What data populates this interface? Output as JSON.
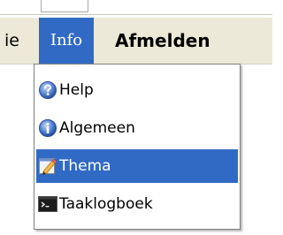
{
  "menubar": {
    "items": [
      {
        "label": "ie"
      },
      {
        "label": "Info",
        "active": true
      },
      {
        "label": "Afmelden"
      }
    ]
  },
  "dropdown": {
    "items": [
      {
        "label": "Help",
        "icon": "help-icon"
      },
      {
        "label": "Algemeen",
        "icon": "info-icon"
      },
      {
        "label": "Thema",
        "icon": "theme-icon",
        "selected": true
      },
      {
        "label": "Taaklogboek",
        "icon": "console-icon"
      }
    ]
  },
  "colors": {
    "menubar_bg": "#ece9d8",
    "selection_bg": "#316ac5",
    "dropdown_bg": "#ffffff"
  }
}
